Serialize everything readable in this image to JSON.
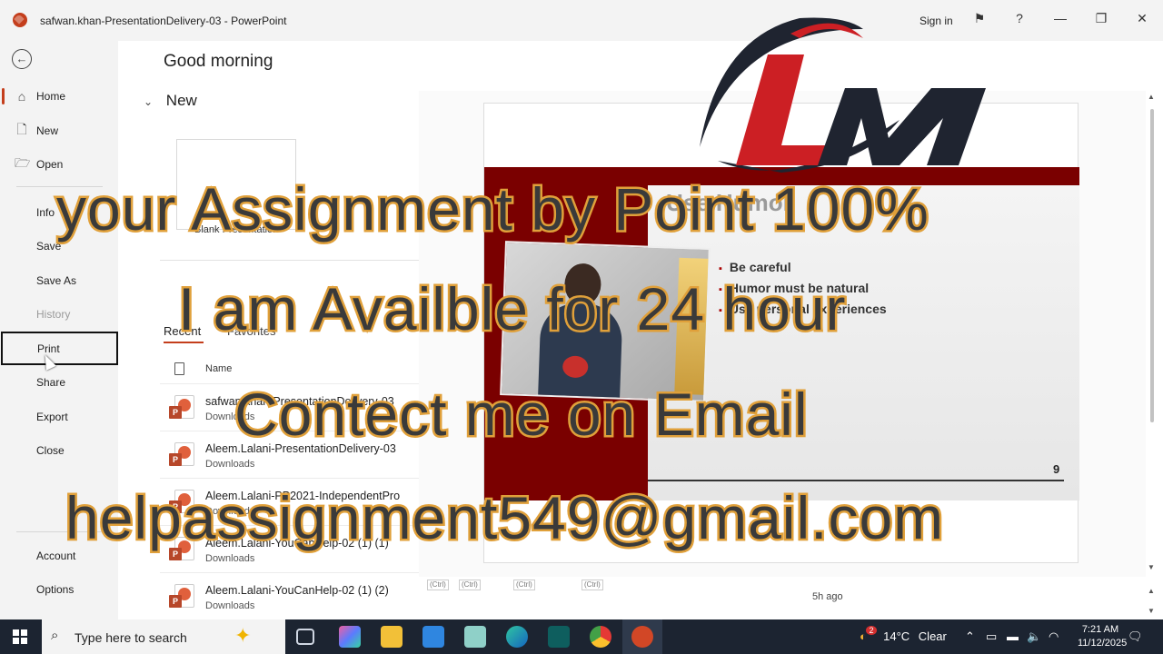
{
  "window": {
    "title": "safwan.khan-PresentationDelivery-03  -  PowerPoint",
    "sign_in": "Sign in",
    "help": "?",
    "minimize": "—",
    "restore": "❐",
    "close": "✕"
  },
  "sidebar": {
    "back": "←",
    "items": [
      {
        "label": "Home",
        "icon": "⌂"
      },
      {
        "label": "New",
        "icon": "🗋"
      },
      {
        "label": "Open",
        "icon": "🗁"
      },
      {
        "label": "Info"
      },
      {
        "label": "Save"
      },
      {
        "label": "Save As"
      },
      {
        "label": "History"
      },
      {
        "label": "Print"
      },
      {
        "label": "Share"
      },
      {
        "label": "Export"
      },
      {
        "label": "Close"
      },
      {
        "label": "Account"
      },
      {
        "label": "Options"
      }
    ]
  },
  "main": {
    "greeting": "Good morning",
    "new_header": "New",
    "chevron": "⌄",
    "blank_label": "Blank Presentation",
    "tabs": {
      "recent": "Recent",
      "favorites": "Favorites"
    },
    "column_name": "Name",
    "files": [
      {
        "name": "safwan.khan-PresentationDelivery-03",
        "location": "Downloads"
      },
      {
        "name": "Aleem.Lalani-PresentationDelivery-03",
        "location": "Downloads"
      },
      {
        "name": "Aleem.Lalani-PP2021-IndependentPro",
        "location": "Downloads"
      },
      {
        "name": "Aleem.Lalani-YouCanHelp-02 (1) (1)",
        "location": "Downloads"
      },
      {
        "name": "Aleem.Lalani-YouCanHelp-02 (1) (2)",
        "location": "Downloads"
      }
    ],
    "time_ago": "5h ago"
  },
  "slide": {
    "title": "Use Humor",
    "bullets": [
      "Be careful",
      "Humor must be natural",
      "Use personal experiences"
    ],
    "page_number": "9",
    "ctrl_chip": "(Ctrl)"
  },
  "overlay": {
    "line1": "your Assignment by Point 100%",
    "line2": "I am Availble for 24 hour",
    "line3": "Contect me on Email",
    "line4": "helpassignment549@gmail.com"
  },
  "taskbar": {
    "search_placeholder": "Type here to search",
    "weather_temp": "14°C",
    "weather_desc": "Clear",
    "weather_badge": "2",
    "time": "7:21 AM",
    "date": "11/12/2025"
  },
  "colors": {
    "accent": "#c43e1c",
    "slide_red": "#7a0000",
    "overlay_fill": "#3a3a3a",
    "overlay_stroke": "#e0a03a",
    "logo_red": "#cc1f24",
    "logo_dark": "#1f2430"
  }
}
